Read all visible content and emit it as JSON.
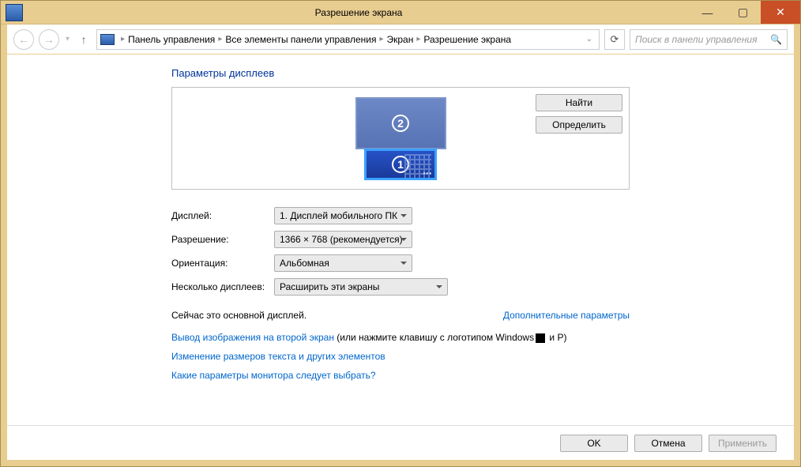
{
  "window": {
    "title": "Разрешение экрана"
  },
  "breadcrumb": {
    "items": [
      "Панель управления",
      "Все элементы панели управления",
      "Экран",
      "Разрешение экрана"
    ]
  },
  "search": {
    "placeholder": "Поиск в панели управления"
  },
  "heading": "Параметры дисплеев",
  "monitors": {
    "primary": "2",
    "secondary": "1"
  },
  "sideButtons": {
    "find": "Найти",
    "identify": "Определить"
  },
  "form": {
    "display_label": "Дисплей:",
    "display_value": "1. Дисплей мобильного ПК",
    "resolution_label": "Разрешение:",
    "resolution_value": "1366 × 768 (рекомендуется)",
    "orientation_label": "Ориентация:",
    "orientation_value": "Альбомная",
    "multi_label": "Несколько дисплеев:",
    "multi_value": "Расширить эти экраны"
  },
  "status": {
    "main_text": "Сейчас это основной дисплей.",
    "advanced_link": "Дополнительные параметры"
  },
  "links": {
    "project_link": "Вывод изображения на второй экран",
    "project_suffix": " (или нажмите клавишу с логотипом Windows",
    "project_tail": " и P)",
    "textsize": "Изменение размеров текста и других элементов",
    "which": "Какие параметры монитора следует выбрать?"
  },
  "footer": {
    "ok": "OK",
    "cancel": "Отмена",
    "apply": "Применить"
  }
}
